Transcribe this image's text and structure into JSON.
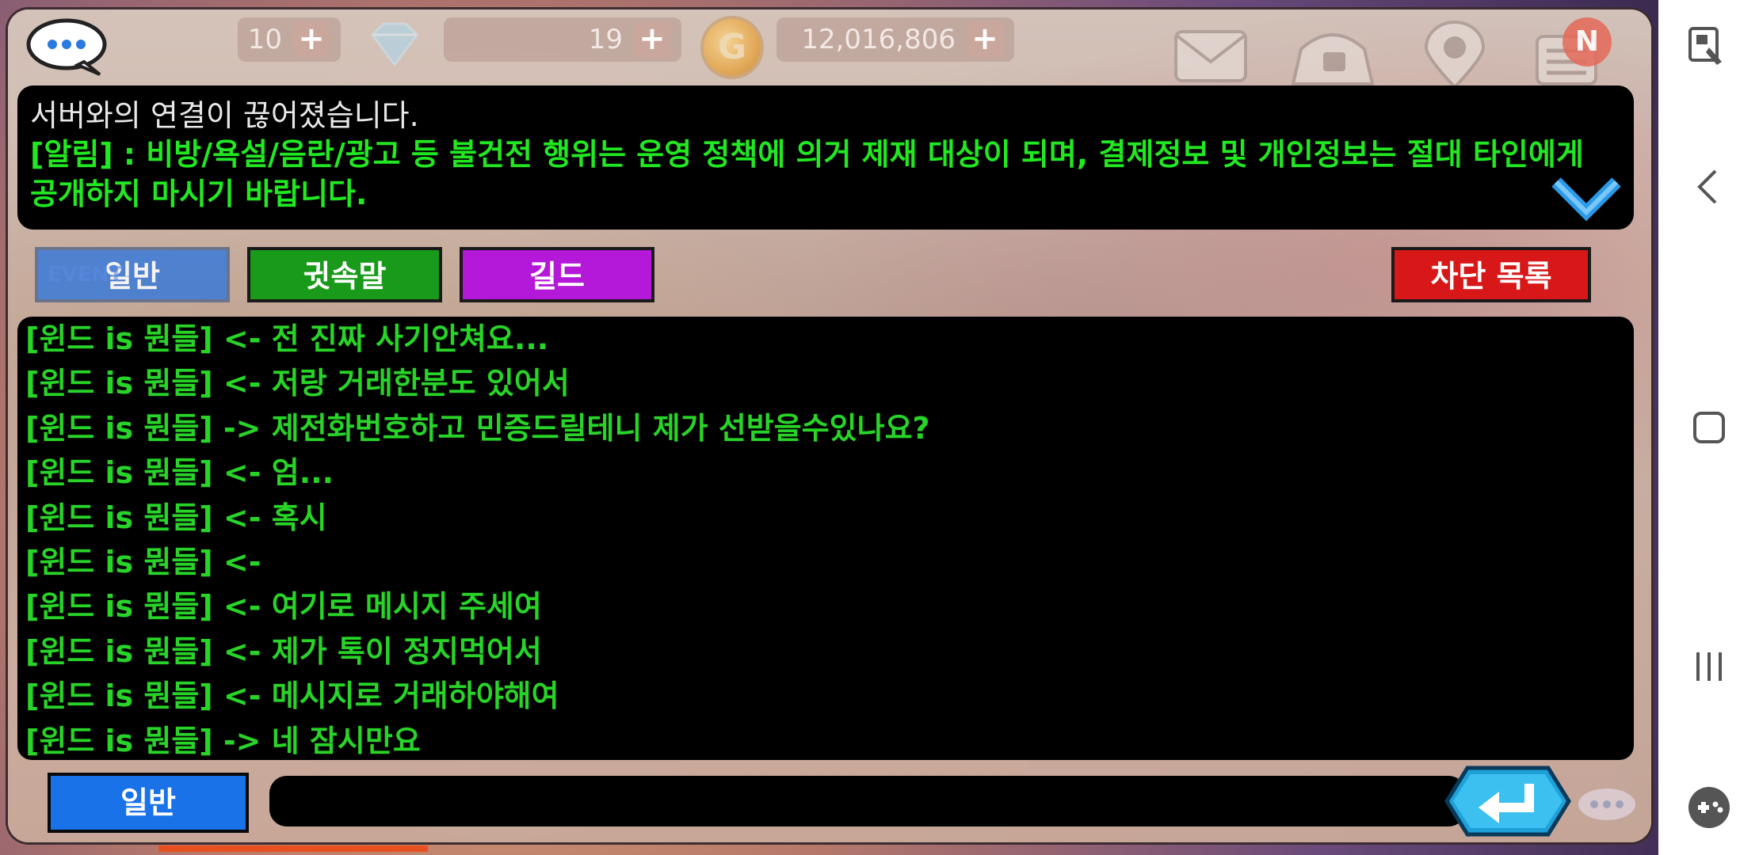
{
  "currency": {
    "hearts": "10",
    "gems": "19",
    "gold": "12,016,806",
    "plus_label": "+",
    "coin_symbol": "G",
    "badge": "N"
  },
  "notice": {
    "line1": "서버와의 연결이 끊어졌습니다.",
    "line2": "[알림] : 비방/욕설/음란/광고 등 불건전 행위는 운영 정책에 의거 제재 대상이 되며, 결제정보 및 개인정보는 절대 타인에게 공개하지 마시기 바랍니다."
  },
  "tabs": {
    "general": "일반",
    "whisper": "귓속말",
    "guild": "길드",
    "block_list": "차단 목록",
    "event_tag": "EVENT"
  },
  "chat": {
    "messages": [
      "[윈드 is 뭔들] <- 전 진짜 사기안쳐요...",
      "[윈드 is 뭔들] <- 저랑 거래한분도 있어서",
      "[윈드 is 뭔들] -> 제전화번호하고 민증드릴테니 제가 선받을수있나요?",
      "[윈드 is 뭔들] <- 엄...",
      "[윈드 is 뭔들] <- 혹시",
      "[윈드 is 뭔들] <- ",
      "[윈드 is 뭔들] <- 여기로 메시지 주세여",
      "[윈드 is 뭔들] <- 제가 톡이 정지먹어서",
      "[윈드 is 뭔들] <- 메시지로 거래하야해여",
      "[윈드 is 뭔들] -> 네 잠시만요"
    ]
  },
  "input": {
    "mode_label": "일반",
    "value": "",
    "placeholder": ""
  },
  "colors": {
    "notice_text": "#22e822",
    "chat_text": "#28d428",
    "tab_whisper": "#1a9a1a",
    "tab_guild": "#b418d8",
    "tab_block": "#d81818",
    "mode_button": "#1a72e8"
  },
  "icons": {
    "chat": "chat-bubble-icon",
    "gem": "diamond-icon",
    "coin": "gold-coin-icon",
    "mail": "mail-icon",
    "shop": "shop-icon",
    "location": "location-pin-icon",
    "menu": "menu-icon",
    "collapse": "chevron-down-icon",
    "send": "enter-icon",
    "more": "more-dots-icon"
  }
}
